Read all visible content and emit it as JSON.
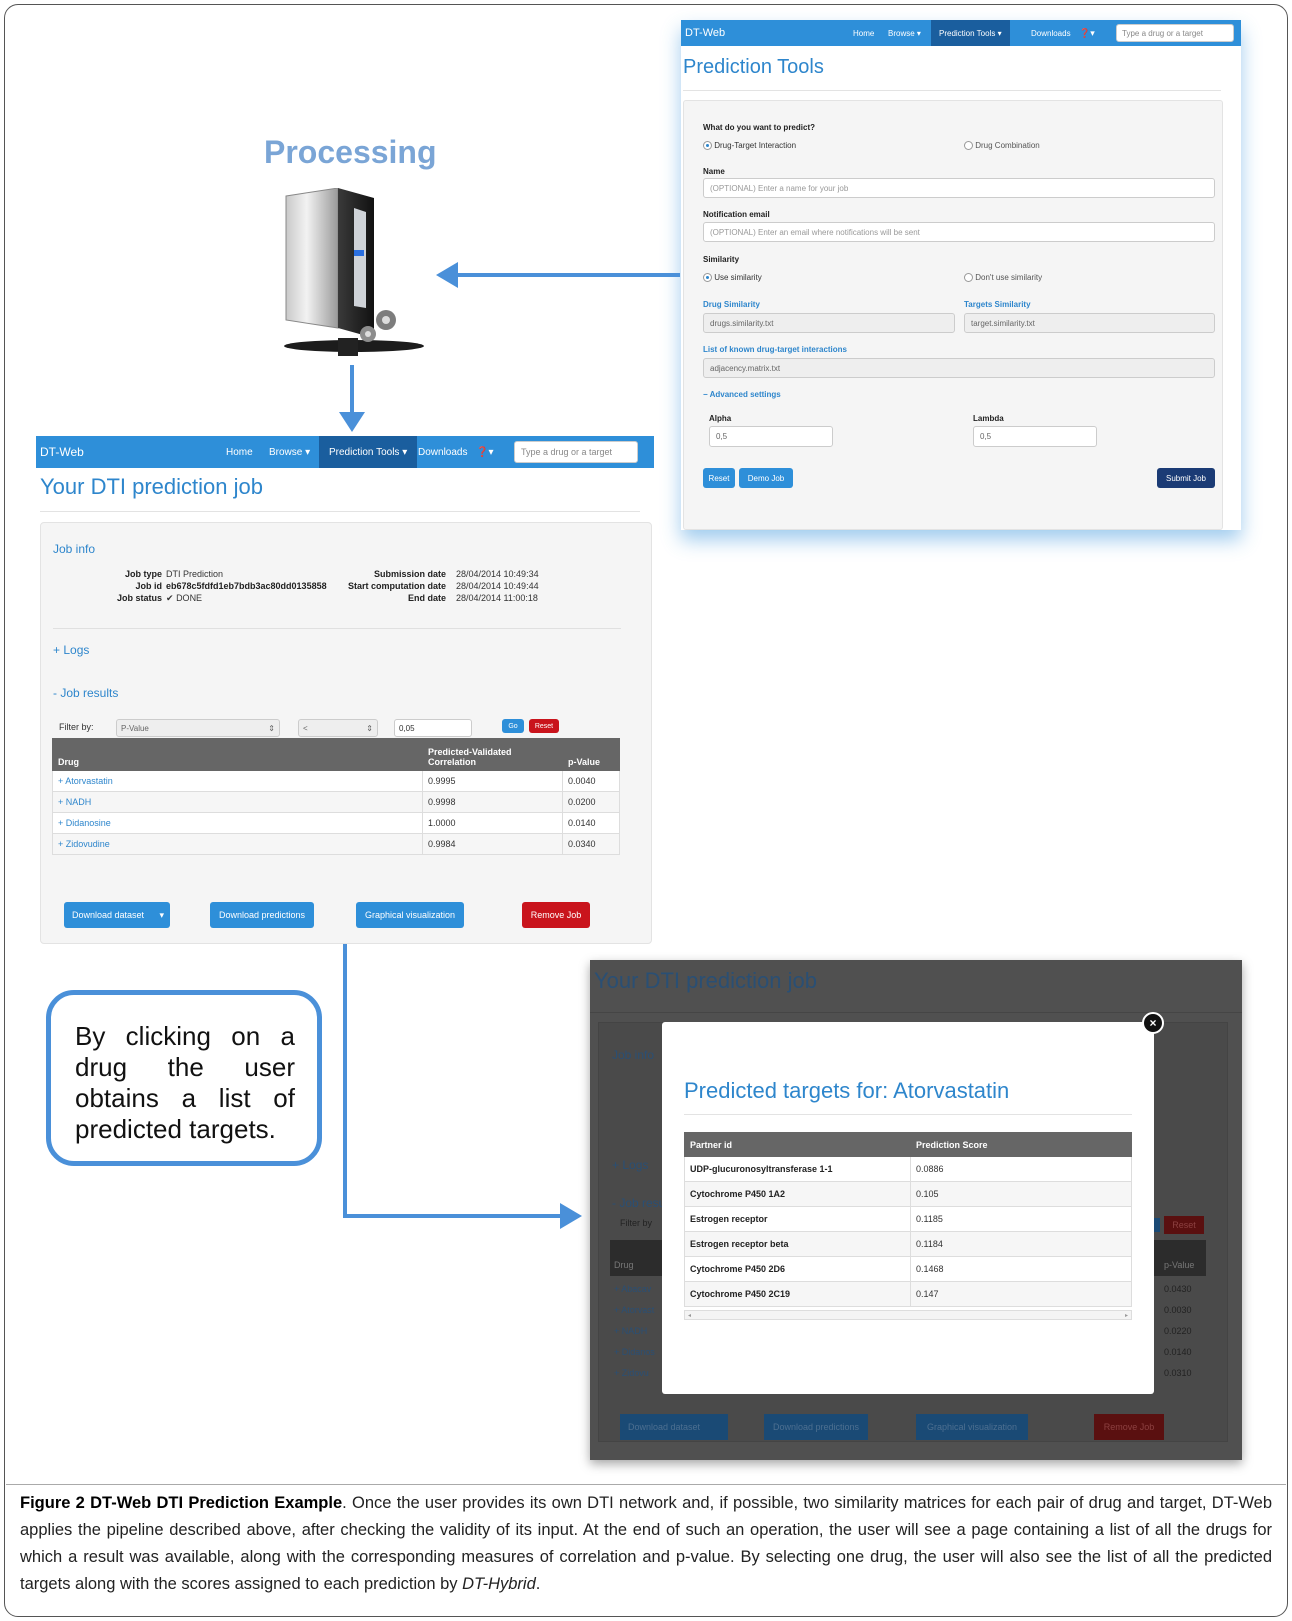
{
  "prediction_tools": {
    "nav": {
      "brand": "DT-Web",
      "items": [
        "Home",
        "Browse",
        "Prediction Tools",
        "Downloads"
      ],
      "search_placeholder": "Type a drug or a target"
    },
    "title": "Prediction Tools",
    "question": "What do you want to predict?",
    "option_dti": "Drug-Target Interaction",
    "option_combo": "Drug Combination",
    "name_label": "Name",
    "name_placeholder": "(OPTIONAL) Enter a name for your job",
    "email_label": "Notification email",
    "email_placeholder": "(OPTIONAL) Enter an email where notifications will be sent",
    "similarity_label": "Similarity",
    "use_similarity": "Use similarity",
    "dont_use_similarity": "Don't use similarity",
    "drug_similarity_label": "Drug Similarity",
    "drug_similarity_value": "drugs.similarity.txt",
    "targets_similarity_label": "Targets Similarity",
    "targets_similarity_value": "target.similarity.txt",
    "interactions_label": "List of known drug-target interactions",
    "interactions_value": "adjacency.matrix.txt",
    "advanced": "Advanced settings",
    "alpha_label": "Alpha",
    "alpha_value": "0,5",
    "lambda_label": "Lambda",
    "lambda_value": "0,5",
    "reset": "Reset",
    "demo": "Demo Job",
    "submit": "Submit Job"
  },
  "processing": {
    "label": "Processing"
  },
  "job": {
    "nav": {
      "brand": "DT-Web",
      "items": [
        "Home",
        "Browse",
        "Prediction Tools",
        "Downloads"
      ],
      "search_placeholder": "Type a drug or a target"
    },
    "title": "Your DTI prediction job",
    "info_title": "Job info",
    "info": {
      "job_type_label": "Job type",
      "job_type": "DTI Prediction",
      "job_id_label": "Job id",
      "job_id": "eb678c5fdfd1eb7bdb3ac80dd0135858",
      "job_status_label": "Job status",
      "job_status": "DONE",
      "submission_label": "Submission date",
      "submission": "28/04/2014 10:49:34",
      "start_label": "Start computation date",
      "start": "28/04/2014 10:49:44",
      "end_label": "End date",
      "end": "28/04/2014 11:00:18"
    },
    "logs": "+ Logs",
    "results": "- Job results",
    "filter_label": "Filter by:",
    "filter_field": "P-Value",
    "filter_op": "<",
    "filter_value": "0,05",
    "go": "Go",
    "reset": "Reset",
    "col_drug": "Drug",
    "col_corr": "Predicted-Validated Correlation",
    "col_p": "p-Value",
    "rows": [
      {
        "drug": "+ Atorvastatin",
        "corr": "0.9995",
        "p": "0.0040"
      },
      {
        "drug": "+ NADH",
        "corr": "0.9998",
        "p": "0.0200"
      },
      {
        "drug": "+ Didanosine",
        "corr": "1.0000",
        "p": "0.0140"
      },
      {
        "drug": "+ Zidovudine",
        "corr": "0.9984",
        "p": "0.0340"
      }
    ],
    "download_dataset": "Download dataset",
    "download_predictions": "Download predictions",
    "graphical": "Graphical visualization",
    "remove": "Remove Job"
  },
  "callout": {
    "text": "By clicking on a drug the user obtains a list of predicted targets."
  },
  "modal_screen": {
    "bg_title": "Your DTI prediction job",
    "bg_job_info": "Job info",
    "bg_logs": "+ Logs",
    "bg_results": "- Job resu",
    "bg_filter": "Filter by",
    "bg_reset": "Reset",
    "bg_drug": "Drug",
    "bg_p": "p-Value",
    "bg_rows": [
      {
        "drug": "+ Abacav",
        "p": "0.0430"
      },
      {
        "drug": "+ Atorvast",
        "p": "0.0030"
      },
      {
        "drug": "+ NADH",
        "p": "0.0220"
      },
      {
        "drug": "+ Didanos",
        "p": "0.0140"
      },
      {
        "drug": "+ Zidovu",
        "p": "0.0310"
      }
    ],
    "bg_download_dataset": "Download dataset",
    "bg_download_predictions": "Download predictions",
    "bg_graphical": "Graphical visualization",
    "bg_remove": "Remove Job",
    "modal_title": "Predicted targets for: Atorvastatin",
    "col_partner": "Partner id",
    "col_score": "Prediction Score",
    "rows": [
      {
        "partner": "UDP-glucuronosyltransferase 1-1",
        "score": "0.0886"
      },
      {
        "partner": "Cytochrome P450 1A2",
        "score": "0.105"
      },
      {
        "partner": "Estrogen receptor",
        "score": "0.1185"
      },
      {
        "partner": "Estrogen receptor beta",
        "score": "0.1184"
      },
      {
        "partner": "Cytochrome P450 2D6",
        "score": "0.1468"
      },
      {
        "partner": "Cytochrome P450 2C19",
        "score": "0.147"
      }
    ]
  },
  "caption": {
    "label": "Figure 2 DT-Web DTI Prediction Example",
    "text1": ". Once the user provides its own DTI network and, if possible, two similarity matrices for each pair of drug and target, DT-Web applies the pipeline described above, after checking the validity of its input. At the end of such an operation, the user will see a page containing a list of all the drugs for which a result was available, along with the corresponding measures of correlation and p-value. By selecting one drug, the user will also see the list of all the predicted targets along with the scores assigned to each prediction by ",
    "italic": "DT-Hybrid",
    "text2": "."
  },
  "colors": {
    "nav": "#2e8fd9",
    "nav_active": "#1a5e9e",
    "link": "#2e86cc",
    "arrow": "#4a90d9",
    "danger": "#c9141c",
    "submit": "#1b3b75"
  }
}
